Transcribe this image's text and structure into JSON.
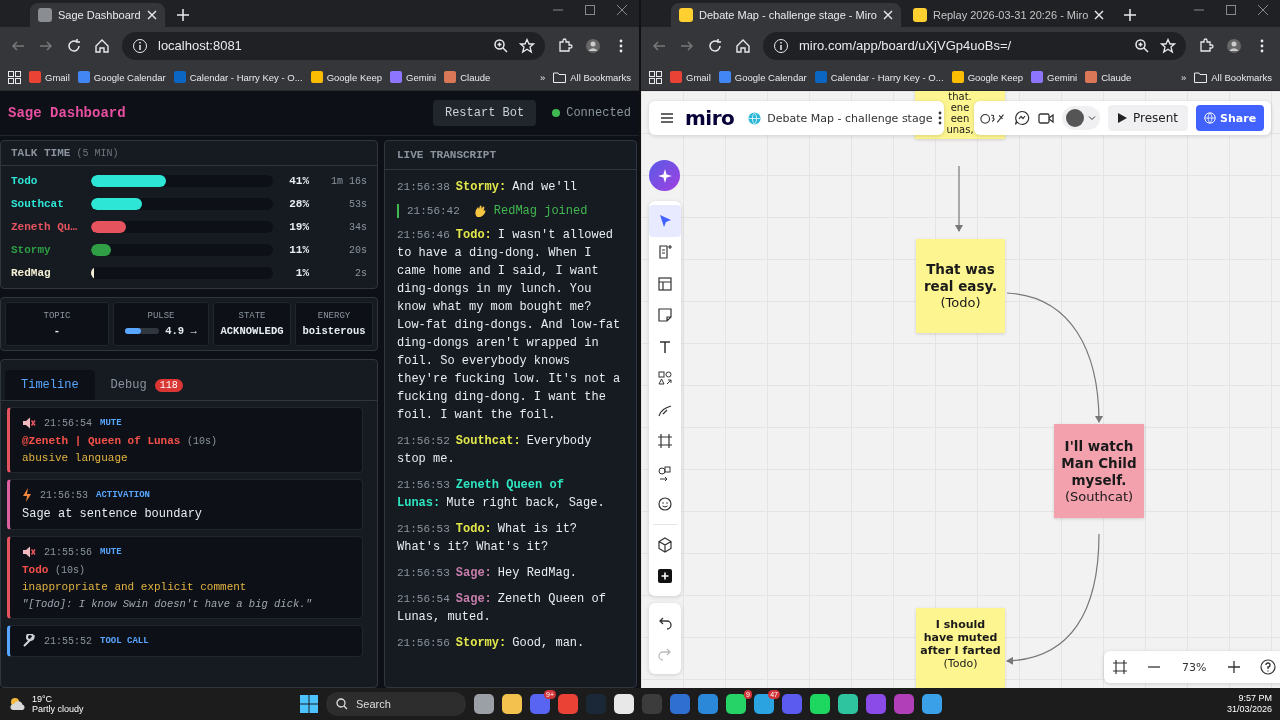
{
  "browsers": [
    {
      "tabs": [
        {
          "title": "Sage Dashboard",
          "selected": true
        }
      ],
      "url": "localhost:8081",
      "bookmarks": [
        "Gmail",
        "Google Calendar",
        "Calendar - Harry Key - O...",
        "Google Keep",
        "Gemini",
        "Claude"
      ],
      "more": "»",
      "all_bookmarks": "All Bookmarks"
    },
    {
      "tabs": [
        {
          "title": "Debate Map - challenge stage - Miro",
          "selected": true
        },
        {
          "title": "Replay 2026-03-31 20:26 - Miro",
          "selected": false
        }
      ],
      "url": "miro.com/app/board/uXjVGp4uoBs=/",
      "bookmarks": [
        "Gmail",
        "Google Calendar",
        "Calendar - Harry Key - O...",
        "Google Keep",
        "Gemini",
        "Claude"
      ],
      "more": "»",
      "all_bookmarks": "All Bookmarks"
    }
  ],
  "dashboard": {
    "title": "Sage Dashboard",
    "restart_button": "Restart Bot",
    "status": {
      "label": "Connected",
      "connected": true
    },
    "talk_time": {
      "title": "TALK TIME",
      "subtitle": "(5 MIN)",
      "speakers": [
        {
          "name": "Todo",
          "color": "#2ee6d6",
          "level": 0.41,
          "percent": "41%",
          "duration": "1m 16s"
        },
        {
          "name": "Southcat",
          "color": "#2ee6d6",
          "level": 0.28,
          "percent": "28%",
          "duration": "53s"
        },
        {
          "name": "Zeneth Qu…",
          "color": "#e5535f",
          "level": 0.19,
          "percent": "19%",
          "duration": "34s"
        },
        {
          "name": "Stormy",
          "color": "#2f9e44",
          "level": 0.11,
          "percent": "11%",
          "duration": "20s"
        },
        {
          "name": "RedMag",
          "color": "#f5f0d6",
          "level": 0.01,
          "percent": "1%",
          "duration": "2s"
        }
      ]
    },
    "stats": [
      {
        "kind": "text",
        "label": "TOPIC",
        "value": "-"
      },
      {
        "kind": "meter",
        "label": "PULSE",
        "value": "4.9 →",
        "level": 0.45
      },
      {
        "kind": "text",
        "label": "STATE",
        "value": "ACKNOWLEDG"
      },
      {
        "kind": "text",
        "label": "ENERGY",
        "value": "boisterous"
      }
    ],
    "tabs": [
      {
        "label": "Timeline",
        "selected": true
      },
      {
        "label": "Debug",
        "selected": false,
        "badge": "118"
      }
    ],
    "timeline": [
      {
        "kind": "mute",
        "time": "21:56:54",
        "type": "MUTE",
        "target": "@Zeneth | Queen of Lunas",
        "duration": "(10s)",
        "reason": "abusive language"
      },
      {
        "kind": "activation",
        "time": "21:56:53",
        "type": "ACTIVATION",
        "text": "Sage at sentence boundary"
      },
      {
        "kind": "mute",
        "time": "21:55:56",
        "type": "MUTE",
        "target": "Todo",
        "duration": "(10s)",
        "reason": "inappropriate and explicit comment",
        "quote": "\"[Todo]: I know Swin doesn't have a big dick.\""
      },
      {
        "kind": "tool_call",
        "time": "21:55:52",
        "type": "TOOL CALL"
      }
    ],
    "transcript": {
      "title": "LIVE TRANSCRIPT",
      "entries": [
        {
          "kind": "message",
          "time": "21:56:38",
          "speaker": "Stormy:",
          "color": "#e3e84a",
          "text": "And we'll"
        },
        {
          "kind": "join",
          "time": "21:56:42",
          "text": "RedMag joined"
        },
        {
          "kind": "message",
          "time": "21:56:46",
          "speaker": "Todo:",
          "color": "#e3e84a",
          "text": "I wasn't allowed to have a ding-dong. When I came home and I said, I want ding-dongs in my lunch. You know what my mom bought me? Low-fat ding-dongs. And low-fat ding-dongs aren't wrapped in foil. So everybody knows they're fucking low. It's not a fucking ding-dong. I want the foil. I want the foil."
        },
        {
          "kind": "message",
          "time": "21:56:52",
          "speaker": "Southcat:",
          "color": "#e3e84a",
          "text": "Everybody stop me."
        },
        {
          "kind": "message",
          "time": "21:56:53",
          "speaker": "Zeneth Queen of Lunas:",
          "color": "#2ee6c0",
          "text": "Mute right back, Sage."
        },
        {
          "kind": "message",
          "time": "21:56:53",
          "speaker": "Todo:",
          "color": "#e3e84a",
          "text": "What is it? What's it? What's it?"
        },
        {
          "kind": "message",
          "time": "21:56:53",
          "speaker": "Sage:",
          "color": "#c77dab",
          "text": "Hey RedMag."
        },
        {
          "kind": "message",
          "time": "21:56:54",
          "speaker": "Sage:",
          "color": "#c77dab",
          "text": "Zeneth Queen of Lunas, muted."
        },
        {
          "kind": "message",
          "time": "21:56:56",
          "speaker": "Stormy:",
          "color": "#e3e84a",
          "text": "Good, man."
        }
      ]
    }
  },
  "miro": {
    "logo": "miro",
    "board_title": "Debate Map - challenge stage",
    "present_button": "Present",
    "share_button": "Share",
    "zoom": "73%",
    "notes": [
      {
        "lines": [
          "that.",
          "ene",
          "een",
          "unas,"
        ],
        "color": "#fdf58f"
      },
      {
        "text": "That was real easy.",
        "author": "(Todo)",
        "color": "#fdf58f"
      },
      {
        "text": "I'll watch Man Child myself.",
        "author": "(Southcat)",
        "color": "#f4a1ae"
      },
      {
        "text": "I should have muted after I farted",
        "author": "(Todo)",
        "color": "#fdf58f"
      }
    ]
  },
  "taskbar": {
    "weather": {
      "temp": "19°C",
      "condition": "Partly cloudy"
    },
    "search": "Search",
    "apps": [
      {
        "color": "#9aa0a6"
      },
      {
        "color": "#f2c14e"
      },
      {
        "color": "#5865f2",
        "badge": "9+"
      },
      {
        "color": "#ea4335"
      },
      {
        "color": "#1b2838"
      },
      {
        "color": "#e8e8e8"
      },
      {
        "color": "#3c3c3c"
      },
      {
        "color": "#2f6fd1"
      },
      {
        "color": "#2b88d8"
      },
      {
        "color": "#25d366",
        "badge": "9"
      },
      {
        "color": "#2aa3e0",
        "badge": "47"
      },
      {
        "color": "#5b5bf0"
      },
      {
        "color": "#1ed760"
      },
      {
        "color": "#2ec4a0"
      },
      {
        "color": "#8a4be8"
      },
      {
        "color": "#b03fb8"
      },
      {
        "color": "#3aa0e8"
      }
    ],
    "time": "9:57 PM",
    "date": "31/03/2026"
  }
}
